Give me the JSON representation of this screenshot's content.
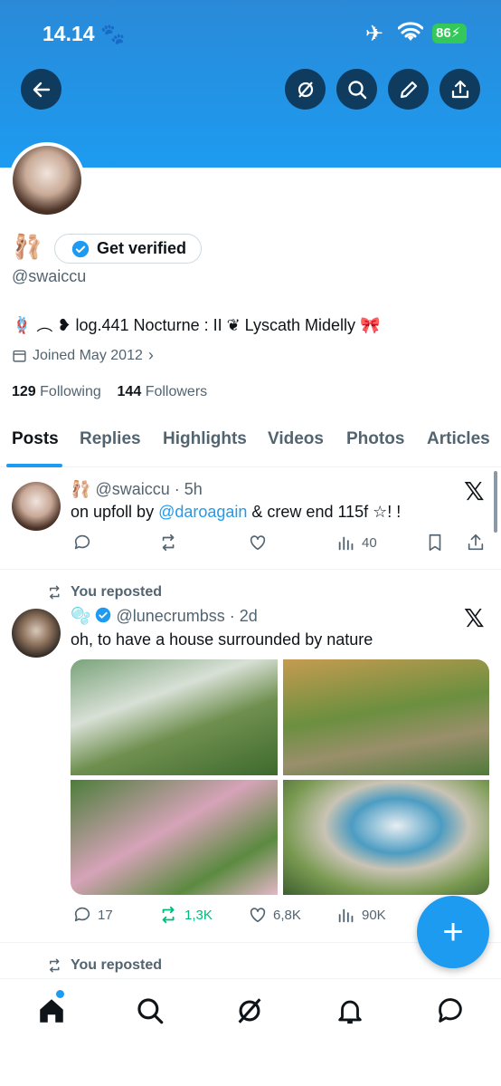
{
  "status_bar": {
    "time": "14.14",
    "battery": "86"
  },
  "profile": {
    "get_verified_label": "Get verified",
    "handle": "@swaiccu",
    "bio": "🪢 ︵ ❥ log.441 Nocturne : II ❦ Lyscath Midelly 🎀",
    "joined": "Joined May 2012",
    "following_count": "129",
    "following_label": "Following",
    "followers_count": "144",
    "followers_label": "Followers",
    "name_emoji": "🩰"
  },
  "tabs": [
    {
      "label": "Posts"
    },
    {
      "label": "Replies"
    },
    {
      "label": "Highlights"
    },
    {
      "label": "Videos"
    },
    {
      "label": "Photos"
    },
    {
      "label": "Articles"
    }
  ],
  "post1": {
    "name_emoji": "🩰",
    "handle": "@swaiccu",
    "time": "· 5h",
    "text_before": "on  upfoll  by ",
    "mention": "@daroagain",
    "text_after": "  &  crew  end  115f  ☆! !",
    "views": "40"
  },
  "post2": {
    "repost_label": "You reposted",
    "name_emoji": "🫧",
    "handle": "@lunecrumbss",
    "time": "· 2d",
    "text": "oh, to have a house surrounded by nature",
    "replies": "17",
    "reposts": "1,3K",
    "likes": "6,8K",
    "views": "90K"
  },
  "post3": {
    "repost_label": "You reposted"
  },
  "colors": {
    "accent": "#1d9bf0",
    "repost_green": "#00ba7c",
    "text_secondary": "#536471"
  }
}
